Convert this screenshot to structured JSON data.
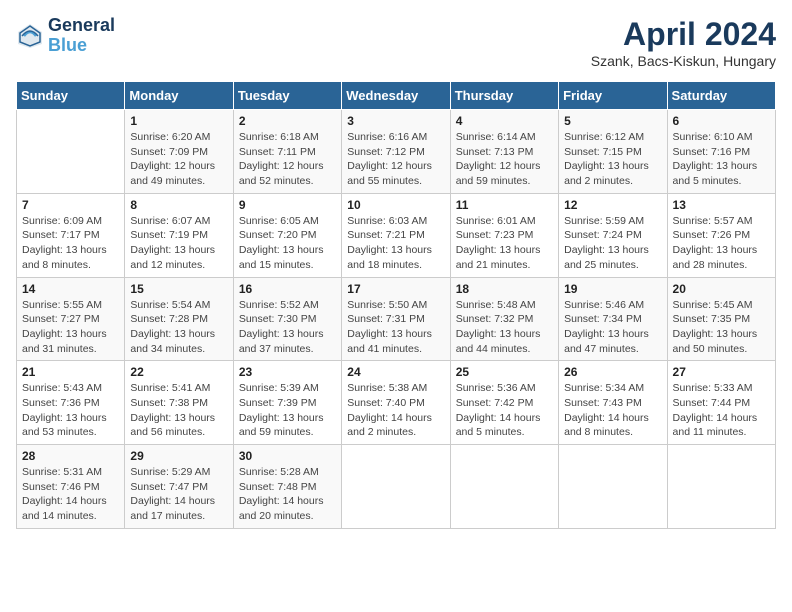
{
  "header": {
    "logo_line1": "General",
    "logo_line2": "Blue",
    "title": "April 2024",
    "subtitle": "Szank, Bacs-Kiskun, Hungary"
  },
  "columns": [
    "Sunday",
    "Monday",
    "Tuesday",
    "Wednesday",
    "Thursday",
    "Friday",
    "Saturday"
  ],
  "weeks": [
    [
      {
        "day": "",
        "info": ""
      },
      {
        "day": "1",
        "info": "Sunrise: 6:20 AM\nSunset: 7:09 PM\nDaylight: 12 hours\nand 49 minutes."
      },
      {
        "day": "2",
        "info": "Sunrise: 6:18 AM\nSunset: 7:11 PM\nDaylight: 12 hours\nand 52 minutes."
      },
      {
        "day": "3",
        "info": "Sunrise: 6:16 AM\nSunset: 7:12 PM\nDaylight: 12 hours\nand 55 minutes."
      },
      {
        "day": "4",
        "info": "Sunrise: 6:14 AM\nSunset: 7:13 PM\nDaylight: 12 hours\nand 59 minutes."
      },
      {
        "day": "5",
        "info": "Sunrise: 6:12 AM\nSunset: 7:15 PM\nDaylight: 13 hours\nand 2 minutes."
      },
      {
        "day": "6",
        "info": "Sunrise: 6:10 AM\nSunset: 7:16 PM\nDaylight: 13 hours\nand 5 minutes."
      }
    ],
    [
      {
        "day": "7",
        "info": "Sunrise: 6:09 AM\nSunset: 7:17 PM\nDaylight: 13 hours\nand 8 minutes."
      },
      {
        "day": "8",
        "info": "Sunrise: 6:07 AM\nSunset: 7:19 PM\nDaylight: 13 hours\nand 12 minutes."
      },
      {
        "day": "9",
        "info": "Sunrise: 6:05 AM\nSunset: 7:20 PM\nDaylight: 13 hours\nand 15 minutes."
      },
      {
        "day": "10",
        "info": "Sunrise: 6:03 AM\nSunset: 7:21 PM\nDaylight: 13 hours\nand 18 minutes."
      },
      {
        "day": "11",
        "info": "Sunrise: 6:01 AM\nSunset: 7:23 PM\nDaylight: 13 hours\nand 21 minutes."
      },
      {
        "day": "12",
        "info": "Sunrise: 5:59 AM\nSunset: 7:24 PM\nDaylight: 13 hours\nand 25 minutes."
      },
      {
        "day": "13",
        "info": "Sunrise: 5:57 AM\nSunset: 7:26 PM\nDaylight: 13 hours\nand 28 minutes."
      }
    ],
    [
      {
        "day": "14",
        "info": "Sunrise: 5:55 AM\nSunset: 7:27 PM\nDaylight: 13 hours\nand 31 minutes."
      },
      {
        "day": "15",
        "info": "Sunrise: 5:54 AM\nSunset: 7:28 PM\nDaylight: 13 hours\nand 34 minutes."
      },
      {
        "day": "16",
        "info": "Sunrise: 5:52 AM\nSunset: 7:30 PM\nDaylight: 13 hours\nand 37 minutes."
      },
      {
        "day": "17",
        "info": "Sunrise: 5:50 AM\nSunset: 7:31 PM\nDaylight: 13 hours\nand 41 minutes."
      },
      {
        "day": "18",
        "info": "Sunrise: 5:48 AM\nSunset: 7:32 PM\nDaylight: 13 hours\nand 44 minutes."
      },
      {
        "day": "19",
        "info": "Sunrise: 5:46 AM\nSunset: 7:34 PM\nDaylight: 13 hours\nand 47 minutes."
      },
      {
        "day": "20",
        "info": "Sunrise: 5:45 AM\nSunset: 7:35 PM\nDaylight: 13 hours\nand 50 minutes."
      }
    ],
    [
      {
        "day": "21",
        "info": "Sunrise: 5:43 AM\nSunset: 7:36 PM\nDaylight: 13 hours\nand 53 minutes."
      },
      {
        "day": "22",
        "info": "Sunrise: 5:41 AM\nSunset: 7:38 PM\nDaylight: 13 hours\nand 56 minutes."
      },
      {
        "day": "23",
        "info": "Sunrise: 5:39 AM\nSunset: 7:39 PM\nDaylight: 13 hours\nand 59 minutes."
      },
      {
        "day": "24",
        "info": "Sunrise: 5:38 AM\nSunset: 7:40 PM\nDaylight: 14 hours\nand 2 minutes."
      },
      {
        "day": "25",
        "info": "Sunrise: 5:36 AM\nSunset: 7:42 PM\nDaylight: 14 hours\nand 5 minutes."
      },
      {
        "day": "26",
        "info": "Sunrise: 5:34 AM\nSunset: 7:43 PM\nDaylight: 14 hours\nand 8 minutes."
      },
      {
        "day": "27",
        "info": "Sunrise: 5:33 AM\nSunset: 7:44 PM\nDaylight: 14 hours\nand 11 minutes."
      }
    ],
    [
      {
        "day": "28",
        "info": "Sunrise: 5:31 AM\nSunset: 7:46 PM\nDaylight: 14 hours\nand 14 minutes."
      },
      {
        "day": "29",
        "info": "Sunrise: 5:29 AM\nSunset: 7:47 PM\nDaylight: 14 hours\nand 17 minutes."
      },
      {
        "day": "30",
        "info": "Sunrise: 5:28 AM\nSunset: 7:48 PM\nDaylight: 14 hours\nand 20 minutes."
      },
      {
        "day": "",
        "info": ""
      },
      {
        "day": "",
        "info": ""
      },
      {
        "day": "",
        "info": ""
      },
      {
        "day": "",
        "info": ""
      }
    ]
  ]
}
